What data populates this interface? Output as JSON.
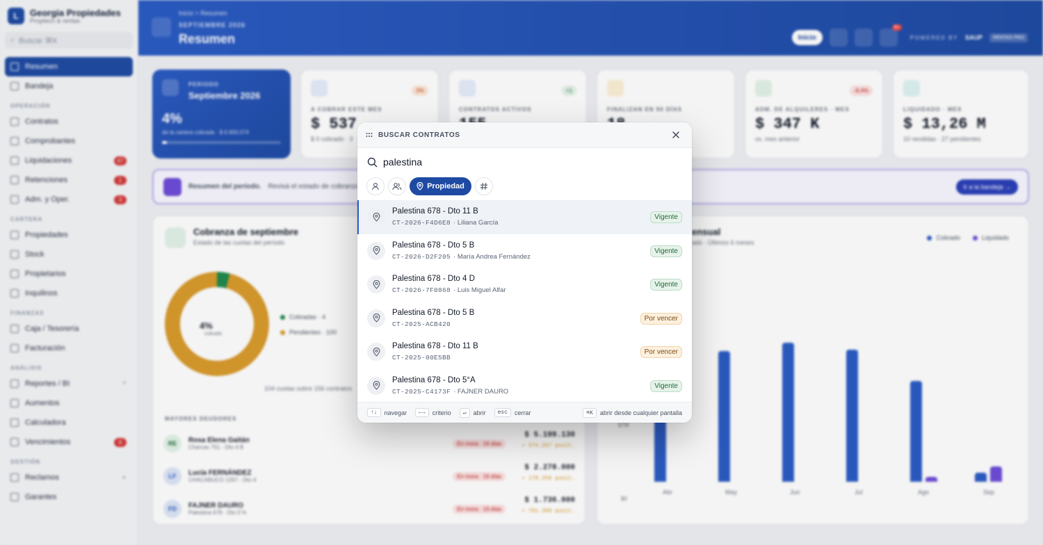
{
  "background": {
    "sidebar": {
      "brand": "Georgia Propiedades",
      "brand_sub": "Proptech & rentas",
      "brand_initial": "L",
      "search": "Buscar  ⌘K",
      "items": [
        {
          "label": "Resumen"
        },
        {
          "label": "Bandeja"
        }
      ],
      "sections": [
        {
          "title": "OPERACIÓN",
          "items": [
            {
              "label": "Contratos"
            },
            {
              "label": "Comprobantes"
            },
            {
              "label": "Liquidaciones",
              "badge": "47"
            },
            {
              "label": "Retenciones",
              "badge": "1"
            },
            {
              "label": "Adm. y Oper.",
              "badge": "3"
            }
          ]
        },
        {
          "title": "CARTERA",
          "items": [
            {
              "label": "Propiedades"
            },
            {
              "label": "Stock"
            },
            {
              "label": "Propietarios"
            },
            {
              "label": "Inquilinos"
            }
          ]
        },
        {
          "title": "FINANZAS",
          "items": [
            {
              "label": "Caja / Tesorería"
            },
            {
              "label": "Facturación"
            }
          ]
        },
        {
          "title": "ANÁLISIS",
          "items": [
            {
              "label": "Reportes / BI",
              "chev": "^"
            },
            {
              "label": "Aumentos"
            },
            {
              "label": "Calculadora"
            },
            {
              "label": "Vencimientos",
              "badge": "6"
            }
          ]
        },
        {
          "title": "GESTIÓN",
          "items": [
            {
              "label": "Reclamos",
              "chev": "+"
            },
            {
              "label": "Garantes"
            }
          ]
        }
      ]
    },
    "header": {
      "breadcrumb": "Inicio  >  Resumen",
      "period": "SEPTIEMBRE 2026",
      "title": "Resumen",
      "inicio": "Inicio",
      "notif": "9+",
      "powered": "POWERED BY",
      "powered_brand": "SAUP",
      "plan": "RENTAS PRO"
    },
    "kpis": [
      {
        "label": "PERIODO",
        "value": "Septiembre 2026",
        "big": "4%",
        "sub": "de la cartera cobrada · $ 6.900.074"
      },
      {
        "label": "A COBRAR ESTE MES",
        "value": "$ 537",
        "sub": "$ 0 cobrado · 3",
        "chip": "0%"
      },
      {
        "label": "CONTRATOS ACTIVOS",
        "value": "155",
        "chip": "+1"
      },
      {
        "label": "FINALIZAN EN 90 DÍAS",
        "value": "18"
      },
      {
        "label": "ADM. DE ALQUILERES · MES",
        "value": "$ 347 K",
        "sub": "vs. mes anterior",
        "chip": "-8,4%"
      },
      {
        "label": "LIQUIDADO · MES",
        "value": "$ 13,26 M",
        "sub": "10 rendidas · 27 pendientes"
      }
    ],
    "banner": {
      "bold": "Resumen del período.",
      "text": "Revisá el estado de cobranza",
      "button": "Ir a la bandeja →"
    },
    "cobranza": {
      "title": "Cobranza de septiembre",
      "sub": "Estado de las cuotas del período",
      "pct": "4%",
      "pct_sub": "cobrado",
      "legend_a": "Cobradas · 4",
      "legend_b": "Pendientes · 100",
      "footer": "104 cuotas sobre 156 contratos",
      "debtors_title": "MAYORES DEUDORES",
      "debtors": [
        {
          "initials": "RE",
          "name": "Rosa Elena Gaitán",
          "addr": "Charcas 751 - Dto 4 B",
          "chip": "En mora · 16 días",
          "amount": "$ 5.199.130",
          "extra": "+ 374.337 punit."
        },
        {
          "initials": "LF",
          "name": "Lucía FERNÁNDEZ",
          "addr": "CHACABUCO 1267 - Dto 4",
          "chip": "En mora · 16 días",
          "amount": "$ 2.278.000",
          "extra": "+ 178.250 punit."
        },
        {
          "initials": "FD",
          "name": "FAJNER DAURO",
          "addr": "Palestina 678 - Dto 5°A",
          "chip": "En mora · 16 días",
          "amount": "$ 1.736.000",
          "extra": "+ 781.300 punit."
        }
      ]
    },
    "mensual": {
      "title": "ensual",
      "sub": "ado · Últimos 6 meses",
      "legend_a": "Cobrado",
      "legend_b": "Liquidado",
      "y_top": "$7M",
      "y_zero": "$0",
      "months": [
        "Abr",
        "May",
        "Jun",
        "Jul",
        "Ago",
        "Sep"
      ]
    }
  },
  "modal": {
    "title": "BUSCAR CONTRATOS",
    "query": "palestina",
    "active_filter": "Propiedad",
    "results": [
      {
        "title": "Palestina 678 - Dto 11 B",
        "code": "CT-2026-F4D6E8",
        "person": "· Liliana García",
        "status": "Vigente",
        "kind": "vig"
      },
      {
        "title": "Palestina 678 - Dto 5 B",
        "code": "CT-2026-D2F205",
        "person": "· María Andrea Fernández",
        "status": "Vigente",
        "kind": "vig"
      },
      {
        "title": "Palestina 678 - Dto 4 D",
        "code": "CT-2026-7F0868",
        "person": "· Luis Miguel Alfar",
        "status": "Vigente",
        "kind": "vig"
      },
      {
        "title": "Palestina 678 - Dto 5 B",
        "code": "CT-2025-ACB420",
        "person": "",
        "status": "Por vencer",
        "kind": "por"
      },
      {
        "title": "Palestina 678 - Dto 11 B",
        "code": "CT-2025-00E5BB",
        "person": "",
        "status": "Por vencer",
        "kind": "por"
      },
      {
        "title": "Palestina 678 - Dto 5°A",
        "code": "CT-2025-C4173F",
        "person": "· FAJNER DAURO",
        "status": "Vigente",
        "kind": "vig"
      }
    ],
    "footer": {
      "nav_key": "↑↓",
      "nav": "navegar",
      "crit_key": "←→",
      "crit": "criterio",
      "open_key": "↵",
      "open": "abrir",
      "esc_key": "esc",
      "esc": "cerrar",
      "k_key": "⌘K",
      "k": "abrir desde cualquier pantalla"
    }
  }
}
